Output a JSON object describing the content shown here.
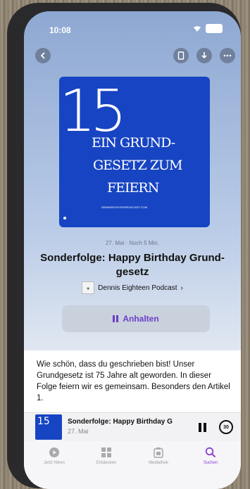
{
  "statusbar": {
    "time": "10:08"
  },
  "episode": {
    "cover": {
      "number": "15",
      "line1": "EIN GRUND-",
      "line2": "GESETZ ZUM",
      "line3": "FEIERN",
      "small_text": "DENNISEIGHTEENPODCAST.COM"
    },
    "meta": "27. Mai · Noch 5 Min.",
    "title": "Sonderfolge: Happy Birthday Grund-gesetz",
    "show_name": "Dennis Eighteen Podcast",
    "show_chevron": "›",
    "pause_label": "Anhalten",
    "description": "Wie schön, dass du geschrieben bist! Unser Grundgesetz ist 75 Jahre alt geworden. In dieser Folge feiern wir es gemeinsam. Besonders den Artikel 1."
  },
  "mini_player": {
    "title": "Sonderfolge: Happy Birthday G",
    "subtitle": "27. Mai",
    "skip_seconds": "30"
  },
  "tabs": [
    {
      "label": "Jetzt hören",
      "icon": "play-circle-icon"
    },
    {
      "label": "Entdecken",
      "icon": "grid-icon"
    },
    {
      "label": "Mediathek",
      "icon": "library-icon"
    },
    {
      "label": "Suchen",
      "icon": "search-icon"
    }
  ],
  "colors": {
    "accent": "#8a3fd1",
    "cover_blue": "#1744c2"
  }
}
